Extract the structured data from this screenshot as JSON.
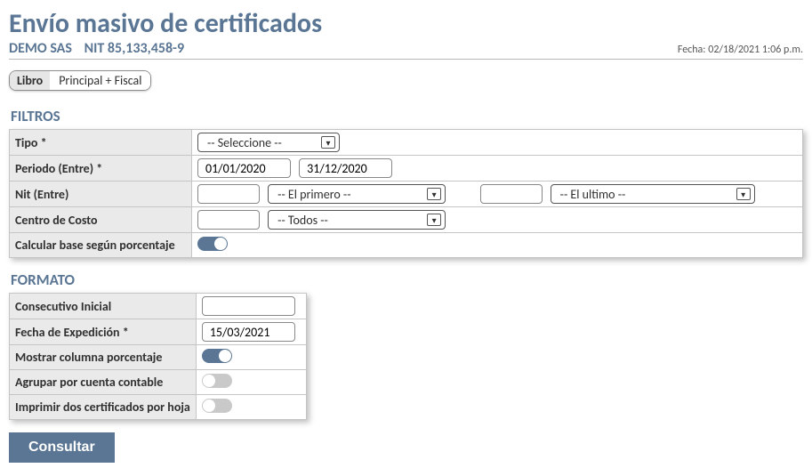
{
  "header": {
    "title": "Envío masivo de certificados",
    "company": "DEMO SAS",
    "nit_label": "NIT",
    "nit_value": "85,133,458-9",
    "date_label": "Fecha:",
    "date_value": "02/18/2021 1:06 p.m."
  },
  "libro": {
    "label": "Libro",
    "value": "Principal + Fiscal"
  },
  "sections": {
    "filtros": "FILTROS",
    "formato": "FORMATO"
  },
  "filtros": {
    "tipo_label": "Tipo *",
    "tipo_value": "-- Seleccione --",
    "periodo_label": "Periodo (Entre) *",
    "periodo_from": "01/01/2020",
    "periodo_to": "31/12/2020",
    "nit_label": "Nit (Entre)",
    "nit_from_value": "",
    "nit_from_select": "-- El primero --",
    "nit_to_value": "",
    "nit_to_select": "-- El ultimo --",
    "centro_label": "Centro de Costo",
    "centro_value": "",
    "centro_select": "-- Todos --",
    "calc_base_label": "Calcular base según porcentaje",
    "calc_base_on": true
  },
  "formato": {
    "consecutivo_label": "Consecutivo Inicial",
    "consecutivo_value": "",
    "fecha_exp_label": "Fecha de Expedición *",
    "fecha_exp_value": "15/03/2021",
    "mostrar_pct_label": "Mostrar columna porcentaje",
    "mostrar_pct_on": true,
    "agrupar_label": "Agrupar por cuenta contable",
    "agrupar_on": false,
    "imprimir_label": "Imprimir dos certificados por hoja",
    "imprimir_on": false
  },
  "actions": {
    "consultar": "Consultar"
  }
}
